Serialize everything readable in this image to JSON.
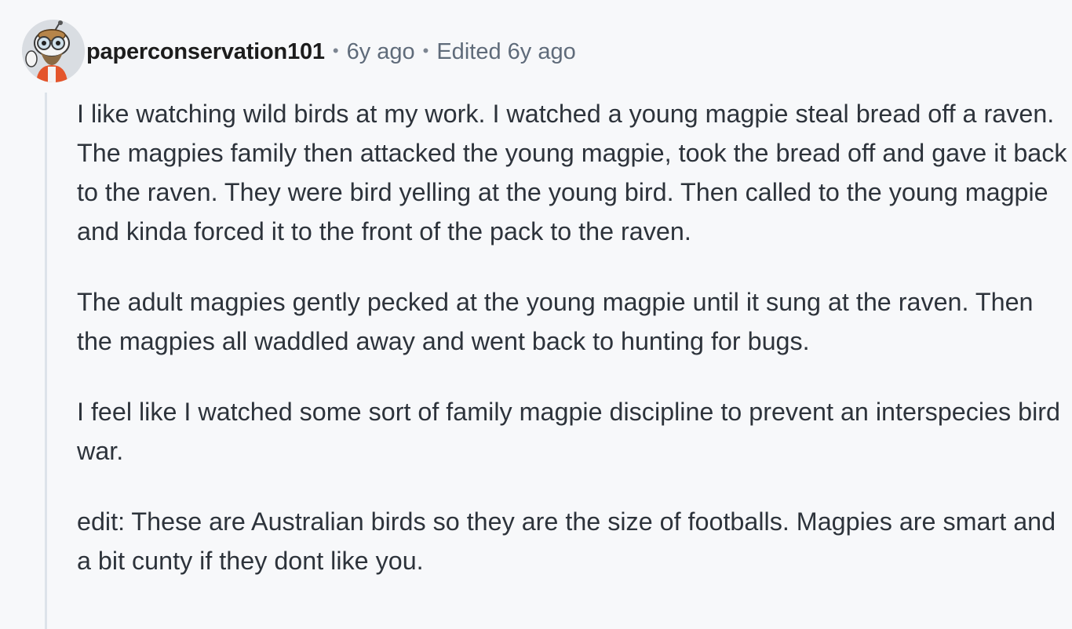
{
  "comment": {
    "username": "paperconservation101",
    "separator": "•",
    "timestamp": "6y ago",
    "edited": "Edited 6y ago",
    "avatar_icon": "snoo-avatar-icon",
    "paragraphs": [
      "I like watching wild birds at my work. I watched a young magpie steal bread off a raven. The magpies family then attacked the young magpie, took the bread off and gave it back to the raven. They were bird yelling at the young bird. Then called to the young magpie and kinda forced it to the front of the pack to the raven.",
      "The adult magpies gently pecked at the young magpie until it sung at the raven. Then the magpies all waddled away and went back to hunting for bugs.",
      "I feel like I watched some sort of family magpie discipline to prevent an interspecies bird war.",
      "edit: These are Australian birds so they are the size of footballs. Magpies are smart and a bit cunty if they dont like you."
    ]
  },
  "colors": {
    "background": "#f7f8fa",
    "username": "#1c1c1c",
    "meta_text": "#5f6b7a",
    "body_text": "#2d333b",
    "thread_line": "#dde3ea"
  }
}
